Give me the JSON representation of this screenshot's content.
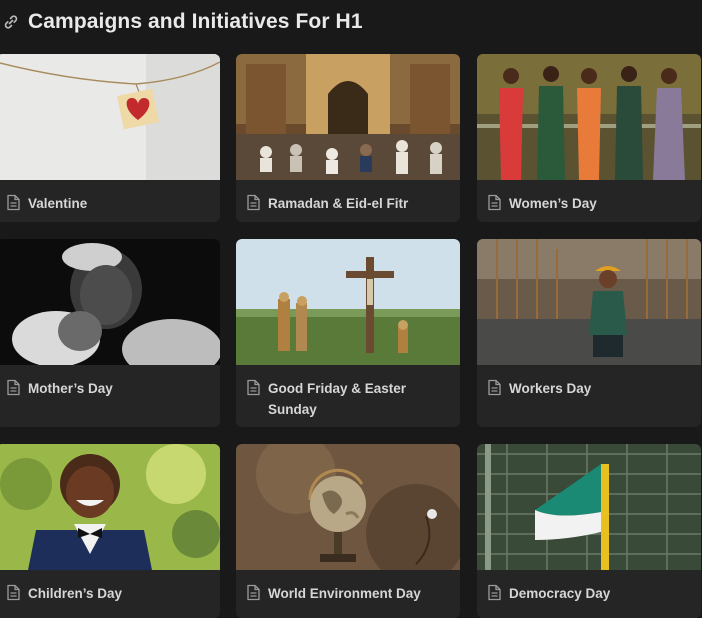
{
  "page": {
    "title": "Campaigns and Initiatives For H1",
    "title_icon": "link-icon"
  },
  "cards": [
    {
      "title": "Valentine",
      "icon": "page-icon",
      "image": "red heart tag hanging on string"
    },
    {
      "title": "Ramadan & Eid-el Fitr",
      "icon": "page-icon",
      "image": "people praying in mosque"
    },
    {
      "title": "Women’s Day",
      "icon": "page-icon",
      "image": "group of women in dresses"
    },
    {
      "title": "Mother’s Day",
      "icon": "page-icon",
      "image": "mother holding child black and white"
    },
    {
      "title": "Good Friday & Easter Sunday",
      "icon": "page-icon",
      "image": "crucifix with statues"
    },
    {
      "title": "Workers Day",
      "icon": "page-icon",
      "image": "worker with hard hat at construction site"
    },
    {
      "title": "Children’s Day",
      "icon": "page-icon",
      "image": "smiling boy with bow tie"
    },
    {
      "title": "World Environment Day",
      "icon": "page-icon",
      "image": "globe on stand"
    },
    {
      "title": "Democracy Day",
      "icon": "page-icon",
      "image": "green and white flag"
    }
  ]
}
